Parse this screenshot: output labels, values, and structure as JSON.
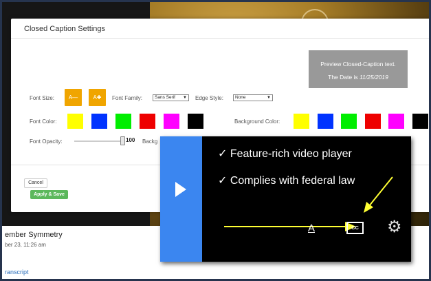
{
  "dialog": {
    "title": "Closed Caption Settings",
    "preview": {
      "line1": "Preview Closed-Caption text.",
      "line2_prefix": "The Date is ",
      "line2_date": "11/25/2019"
    },
    "font_size": {
      "label": "Font Size:",
      "decrease_label": "A—",
      "increase_label": "A✚"
    },
    "font_family": {
      "label": "Font Family:",
      "value": "Sans Serif"
    },
    "edge_style": {
      "label": "Edge Style:",
      "value": "None"
    },
    "font_color": {
      "label": "Font Color:",
      "swatches": [
        "#ffff00",
        "#0033ff",
        "#00ee00",
        "#ee0000",
        "#ff00ff",
        "#000000"
      ]
    },
    "background_color": {
      "label": "Background Color:",
      "label_partial": "Backg",
      "swatches": [
        "#ffff00",
        "#0033ff",
        "#00ee00",
        "#ee0000",
        "#ff00ff",
        "#000000"
      ]
    },
    "font_opacity": {
      "label": "Font Opacity:",
      "value": "100"
    },
    "cancel_label": "Cancel",
    "apply_label": "Apply & Save"
  },
  "page": {
    "video_title": "ember Symmetry",
    "video_date": "ber 23, 11:26 am",
    "transcript_link": "ranscript"
  },
  "promo": {
    "line1": "✓ Feature-rich video player",
    "line2": "✓ Complies with federal law",
    "font_icon_glyph": "A",
    "cc_icon_label": "CC",
    "gear_glyph": "⚙",
    "arrow_color": "#ffff33"
  }
}
